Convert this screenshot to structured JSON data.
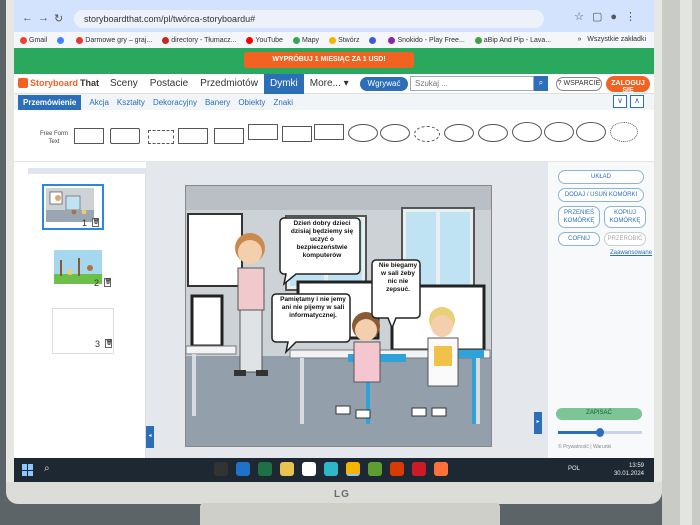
{
  "browser": {
    "url": "storyboardthat.com/pl/twórca-storyboardu#",
    "bookmarks": [
      {
        "label": "Gmail",
        "color": "#ea4335"
      },
      {
        "label": "",
        "color": "#4285f4"
      },
      {
        "label": "Darmowe gry – graj...",
        "color": "#e53935"
      },
      {
        "label": "directory - Tłumacz...",
        "color": "#c62828"
      },
      {
        "label": "YouTube",
        "color": "#ff0000"
      },
      {
        "label": "Mapy",
        "color": "#34a853"
      },
      {
        "label": "Stwórz",
        "color": "#f4b400"
      },
      {
        "label": "",
        "color": "#3b5bdb"
      },
      {
        "label": "Snokido - Play Free...",
        "color": "#8e24aa"
      },
      {
        "label": "aBip And Pip - Lava...",
        "color": "#43a047"
      }
    ],
    "bookmarks_more": "»",
    "all_bookmarks": "Wszystkie zakładki"
  },
  "promo": {
    "label": "WYPRÓBUJ 1 MIESIĄC ZA 1 USD!"
  },
  "header": {
    "brand_a": "Storyboard",
    "brand_b": "That",
    "menu": [
      {
        "label": "Sceny",
        "active": false
      },
      {
        "label": "Postacie",
        "active": false
      },
      {
        "label": "Przedmiotów",
        "active": false
      },
      {
        "label": "Dymki",
        "active": true
      },
      {
        "label": "More... ▾",
        "active": false
      }
    ],
    "upload": "Wgrywać",
    "search_placeholder": "Szukaj ...",
    "support": "? WSPARCIE",
    "login": "ZALOGUJ SIĘ"
  },
  "tabs": [
    {
      "label": "Przemówienie",
      "active": true
    },
    {
      "label": "Akcja",
      "active": false
    },
    {
      "label": "Kształty",
      "active": false
    },
    {
      "label": "Dekoracyjny",
      "active": false
    },
    {
      "label": "Banery",
      "active": false
    },
    {
      "label": "Obiekty",
      "active": false
    },
    {
      "label": "Znaki",
      "active": false
    }
  ],
  "shelf": {
    "label_line1": "Free Form",
    "label_line2": "Text"
  },
  "cells": [
    "1",
    "2",
    "3"
  ],
  "scene": {
    "bubble_teacher": "Dzień dobry dzieci dzisiaj będziemy się uczyć o bezpieczeństwie komputerów",
    "bubble_girl": "Pamiętamy i nie jemy ani nie pijemy w sali informatycznej.",
    "bubble_boy": "Nie biegamy w sali żeby nic nie zepsuć."
  },
  "right_panel": {
    "layout": "UKŁAD",
    "add_remove": "DODAJ / USUŃ KOMÓRKI",
    "move_cells": "PRZENIEŚ KOMÓRKĘ",
    "copy_cells": "KOPIUJ KOMÓRKĘ",
    "undo": "COFNIJ",
    "redo": "PRZEROBIĆ",
    "advanced": "Zaawansowane",
    "save": "ZAPISAĆ",
    "zoom_fraction": 0.5,
    "copyright": "© Prywatność | Warunki"
  },
  "taskbar": {
    "lang": "POL",
    "time": "13:59",
    "date": "30.01.2024"
  },
  "monitor": {
    "brand": "LG"
  }
}
